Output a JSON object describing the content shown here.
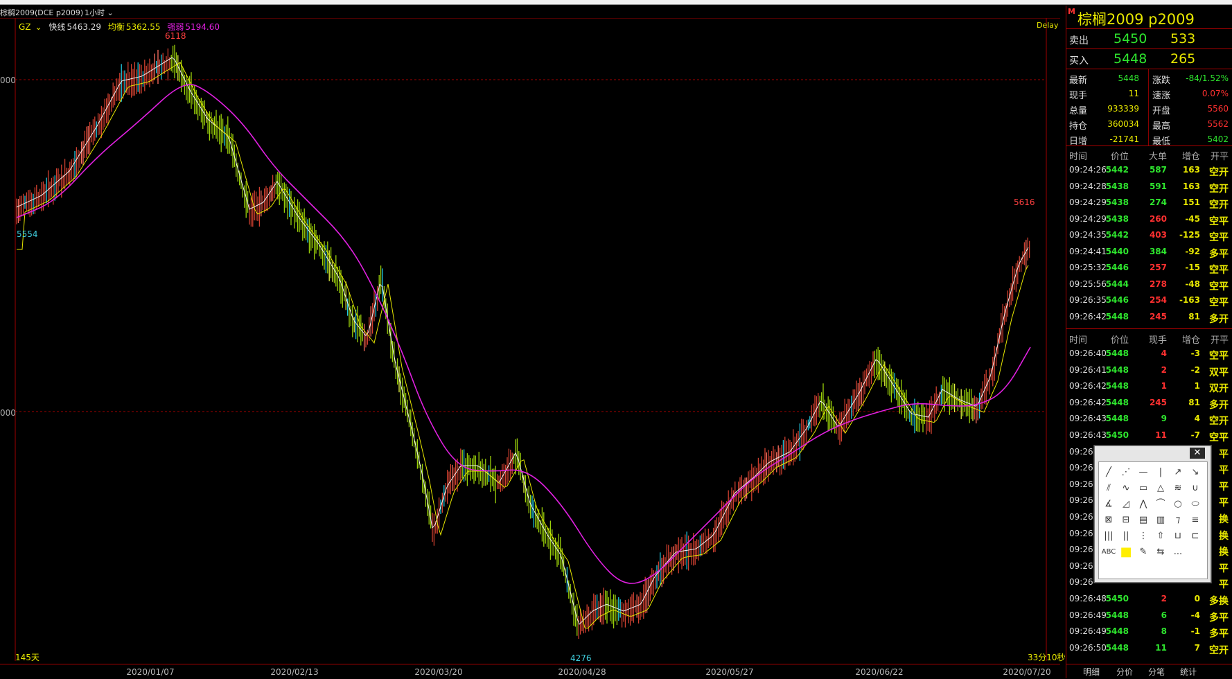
{
  "header": {
    "symbol_title": "棕榈2009(DCE p2009)",
    "period": "1小时",
    "period_arrow": "chevron-down"
  },
  "legend": {
    "indicator": "GZ",
    "fast_label": "快线",
    "fast_value": "5463.29",
    "avg_label": "均衡",
    "avg_value": "5362.55",
    "strength_label": "强弱",
    "strength_value": "5194.60",
    "delay": "Delay"
  },
  "chart": {
    "y_labels": [
      "000",
      "000"
    ],
    "price_marks": {
      "high_label": "6118",
      "start_label": "5554",
      "low_label": "4276",
      "recent_high_label": "5616"
    },
    "x_ticks": [
      "2020/01/07",
      "2020/02/13",
      "2020/03/20",
      "2020/04/28",
      "2020/05/27",
      "2020/06/22",
      "2020/07/20"
    ],
    "bottom_left": "145天",
    "bottom_right": "33分10秒",
    "colors": {
      "ma": "#e020e0",
      "up": "#d04030",
      "down": "#9ad00a",
      "grid": "#a00000"
    }
  },
  "chart_data": {
    "type": "line",
    "x": [
      "2020/01/07",
      "2020/02/13",
      "2020/03/20",
      "2020/04/28",
      "2020/05/27",
      "2020/06/22",
      "2020/07/20"
    ],
    "series": [
      {
        "name": "强弱",
        "values": [
          5900,
          5700,
          4930,
          4430,
          4820,
          5110,
          5300
        ]
      }
    ]
  },
  "panel": {
    "m_badge": "M",
    "title": "棕榈2009  p2009",
    "sell_label": "卖出",
    "sell_price": "5450",
    "sell_vol": "533",
    "buy_label": "买入",
    "buy_price": "5448",
    "buy_vol": "265",
    "quote": [
      {
        "k1": "最新",
        "v1": "5448",
        "c1": "#2ee62e",
        "k2": "涨跌",
        "v2": "-84/1.52%",
        "c2": "#2ee62e"
      },
      {
        "k1": "现手",
        "v1": "11",
        "c1": "#e8e800",
        "k2": "速涨",
        "v2": "0.07%",
        "c2": "#ff3030"
      },
      {
        "k1": "总量",
        "v1": "933339",
        "c1": "#e8e800",
        "k2": "开盘",
        "v2": "5560",
        "c2": "#ff3030"
      },
      {
        "k1": "持仓",
        "v1": "360034",
        "c1": "#e8e800",
        "k2": "最高",
        "v2": "5562",
        "c2": "#ff3030"
      },
      {
        "k1": "日增",
        "v1": "-21741",
        "c1": "#e8e800",
        "k2": "最低",
        "v2": "5402",
        "c2": "#2ee62e"
      }
    ],
    "big_header": {
      "time": "时间",
      "price": "价位",
      "vol": "大单",
      "oi": "增仓",
      "kind": "开平"
    },
    "big_trades": [
      {
        "time": "09:24:26",
        "price": "5442",
        "vol": "587",
        "vc": "#2ee62e",
        "oi": "163",
        "kind": "空开"
      },
      {
        "time": "09:24:28",
        "price": "5438",
        "vol": "591",
        "vc": "#2ee62e",
        "oi": "163",
        "kind": "空开"
      },
      {
        "time": "09:24:29",
        "price": "5438",
        "vol": "274",
        "vc": "#2ee62e",
        "oi": "151",
        "kind": "空开"
      },
      {
        "time": "09:24:29",
        "price": "5438",
        "vol": "260",
        "vc": "#ff3030",
        "oi": "-45",
        "kind": "空平"
      },
      {
        "time": "09:24:35",
        "price": "5442",
        "vol": "403",
        "vc": "#ff3030",
        "oi": "-125",
        "kind": "空平"
      },
      {
        "time": "09:24:41",
        "price": "5440",
        "vol": "384",
        "vc": "#2ee62e",
        "oi": "-92",
        "kind": "多平"
      },
      {
        "time": "09:25:32",
        "price": "5446",
        "vol": "257",
        "vc": "#ff3030",
        "oi": "-15",
        "kind": "空平"
      },
      {
        "time": "09:25:56",
        "price": "5444",
        "vol": "278",
        "vc": "#ff3030",
        "oi": "-48",
        "kind": "空平"
      },
      {
        "time": "09:26:35",
        "price": "5446",
        "vol": "254",
        "vc": "#ff3030",
        "oi": "-163",
        "kind": "空平"
      },
      {
        "time": "09:26:42",
        "price": "5448",
        "vol": "245",
        "vc": "#ff3030",
        "oi": "81",
        "kind": "多开"
      }
    ],
    "tick_header": {
      "time": "时间",
      "price": "价位",
      "vol": "现手",
      "oi": "增仓",
      "kind": "开平"
    },
    "ticks": [
      {
        "time": "09:26:40",
        "price": "5448",
        "vol": "4",
        "vc": "#ff3030",
        "oi": "-3",
        "kind": "空平"
      },
      {
        "time": "09:26:41",
        "price": "5448",
        "vol": "2",
        "vc": "#ff3030",
        "oi": "-2",
        "kind": "双平"
      },
      {
        "time": "09:26:42",
        "price": "5448",
        "vol": "1",
        "vc": "#ff3030",
        "oi": "1",
        "kind": "双开"
      },
      {
        "time": "09:26:42",
        "price": "5448",
        "vol": "245",
        "vc": "#ff3030",
        "oi": "81",
        "kind": "多开"
      },
      {
        "time": "09:26:43",
        "price": "5448",
        "vol": "9",
        "vc": "#2ee62e",
        "oi": "4",
        "kind": "空开"
      },
      {
        "time": "09:26:43",
        "price": "5450",
        "vol": "11",
        "vc": "#ff3030",
        "oi": "-7",
        "kind": "空平"
      },
      {
        "time": "09:26:4",
        "price": "",
        "vol": "",
        "vc": "#2ee62e",
        "oi": "",
        "kind": "平"
      },
      {
        "time": "09:26:4",
        "price": "",
        "vol": "",
        "vc": "#2ee62e",
        "oi": "",
        "kind": "平"
      },
      {
        "time": "09:26",
        "price": "",
        "vol": "",
        "vc": "#2ee62e",
        "oi": "",
        "kind": "平"
      },
      {
        "time": "09:26",
        "price": "",
        "vol": "",
        "vc": "#2ee62e",
        "oi": "",
        "kind": "平"
      },
      {
        "time": "09:26",
        "price": "",
        "vol": "",
        "vc": "#2ee62e",
        "oi": "",
        "kind": "换"
      },
      {
        "time": "09:26",
        "price": "",
        "vol": "",
        "vc": "#2ee62e",
        "oi": "",
        "kind": "换"
      },
      {
        "time": "09:26",
        "price": "",
        "vol": "",
        "vc": "#2ee62e",
        "oi": "",
        "kind": "换"
      },
      {
        "time": "09:26",
        "price": "",
        "vol": "",
        "vc": "#2ee62e",
        "oi": "",
        "kind": "平"
      },
      {
        "time": "09:26",
        "price": "",
        "vol": "",
        "vc": "#2ee62e",
        "oi": "",
        "kind": "平"
      },
      {
        "time": "09:26:48",
        "price": "5450",
        "vol": "2",
        "vc": "#ff3030",
        "oi": "0",
        "kind": "多换"
      },
      {
        "time": "09:26:49",
        "price": "5448",
        "vol": "6",
        "vc": "#2ee62e",
        "oi": "-4",
        "kind": "多平"
      },
      {
        "time": "09:26:49",
        "price": "5448",
        "vol": "8",
        "vc": "#2ee62e",
        "oi": "-1",
        "kind": "多平"
      },
      {
        "time": "09:26:50",
        "price": "5448",
        "vol": "11",
        "vc": "#2ee62e",
        "oi": "7",
        "kind": "空开"
      }
    ],
    "tabs": [
      "明细",
      "分价",
      "分笔",
      "统计"
    ]
  },
  "palette": {
    "close": "✕",
    "abc": "ABC",
    "more": "..."
  }
}
